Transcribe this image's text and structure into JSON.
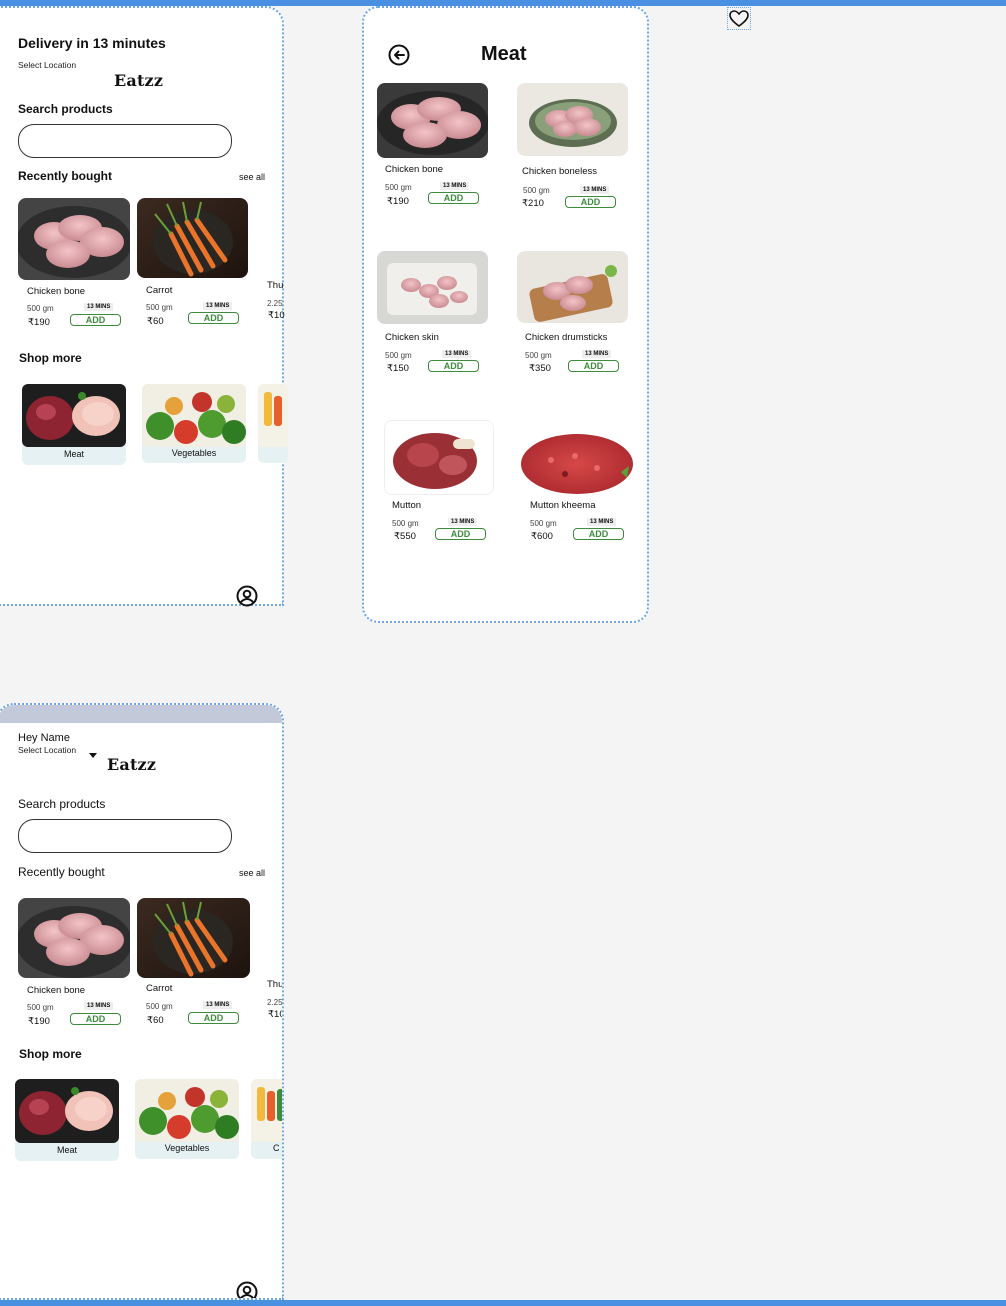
{
  "colors": {
    "accent_blue": "#4a90e2",
    "add_green": "#3d8b3d",
    "card_bg": "#e5f1f2",
    "top_band": "#c3c9d8"
  },
  "icons": {
    "heart": "heart-icon",
    "back": "back-arrow-icon",
    "profile": "profile-icon",
    "dropdown": "caret-down-icon"
  },
  "home": {
    "delivery_title": "Delivery in 13 minutes",
    "select_location": "Select Location",
    "brand": "Eatzz",
    "search_label": "Search products",
    "search_placeholder": "",
    "recent_title": "Recently bought",
    "see_all": "see all",
    "recent": [
      {
        "name": "Chicken bone",
        "weight": "500 gm",
        "price": "₹190",
        "mins": "13 MINS",
        "add": "ADD"
      },
      {
        "name": "Carrot",
        "weight": "500 gm",
        "price": "₹60",
        "mins": "13 MINS",
        "add": "ADD"
      },
      {
        "name": "Thu",
        "weight": "2.25",
        "price": "₹10"
      }
    ],
    "shop_more_title": "Shop more",
    "shop": [
      {
        "label": "Meat"
      },
      {
        "label": "Vegetables"
      }
    ]
  },
  "meat": {
    "title": "Meat",
    "products": [
      {
        "name": "Chicken bone",
        "weight": "500 gm",
        "price": "₹190",
        "mins": "13 MINS",
        "add": "ADD"
      },
      {
        "name": "Chicken boneless",
        "weight": "500 gm",
        "price": "₹210",
        "mins": "13 MINS",
        "add": "ADD"
      },
      {
        "name": "Chicken skin",
        "weight": "500 gm",
        "price": "₹150",
        "mins": "13 MINS",
        "add": "ADD"
      },
      {
        "name": "Chicken drumsticks",
        "weight": "500 gm",
        "price": "₹350",
        "mins": "13 MINS",
        "add": "ADD"
      },
      {
        "name": "Mutton",
        "weight": "500 gm",
        "price": "₹550",
        "mins": "13 MINS",
        "add": "ADD"
      },
      {
        "name": "Mutton kheema",
        "weight": "500 gm",
        "price": "₹600",
        "mins": "13 MINS",
        "add": "ADD"
      }
    ]
  },
  "home2": {
    "greeting": "Hey Name",
    "select_location": "Select Location",
    "brand": "Eatzz",
    "search_label": "Search products",
    "search_placeholder": "",
    "recent_title": "Recently bought",
    "see_all": "see all",
    "recent": [
      {
        "name": "Chicken bone",
        "weight": "500 gm",
        "price": "₹190",
        "mins": "13 MINS",
        "add": "ADD"
      },
      {
        "name": "Carrot",
        "weight": "500 gm",
        "price": "₹60",
        "mins": "13 MINS",
        "add": "ADD"
      },
      {
        "name": "Thu",
        "weight": "2.25",
        "price": "₹10"
      }
    ],
    "shop_more_title": "Shop more",
    "shop": [
      {
        "label": "Meat"
      },
      {
        "label": "Vegetables"
      },
      {
        "label": "C"
      }
    ]
  }
}
